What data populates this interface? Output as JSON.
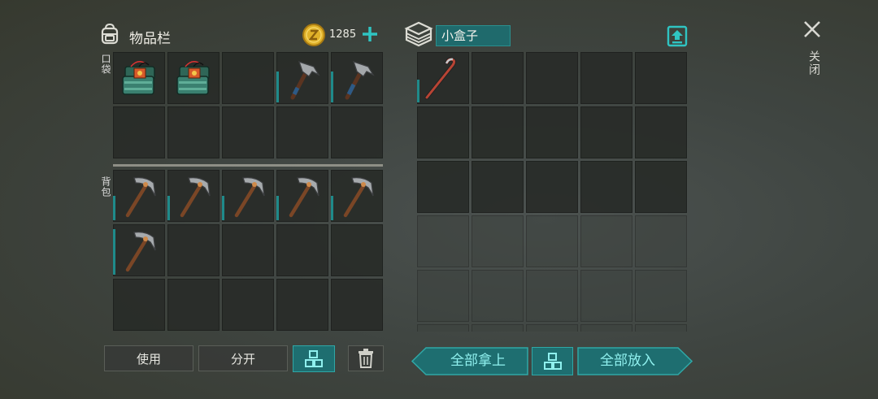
{
  "inventory": {
    "title": "物品栏",
    "coins": "1285",
    "pocket_label": "口袋",
    "backpack_label": "背包"
  },
  "container": {
    "name": "小盒子"
  },
  "close_label": "关闭",
  "buttons": {
    "use": "使用",
    "split": "分开",
    "take_all": "全部拿上",
    "put_all": "全部放入"
  },
  "pocket_slots": [
    "battery-pack",
    "battery-pack",
    "",
    "hammer",
    "hammer",
    "",
    "",
    "",
    "",
    ""
  ],
  "backpack_slots": [
    "pickaxe",
    "pickaxe",
    "pickaxe",
    "pickaxe",
    "pickaxe",
    "pickaxe",
    "",
    "",
    "",
    "",
    "",
    "",
    "",
    "",
    ""
  ],
  "container_slots": [
    "crowbar",
    "",
    "",
    "",
    "",
    "",
    "",
    "",
    "",
    "",
    "",
    "",
    "",
    "",
    "",
    "",
    "",
    "",
    "",
    "",
    "",
    "",
    "",
    "",
    "",
    "",
    "",
    "",
    "",
    ""
  ],
  "colors": {
    "accent": "#2fa7a6",
    "teal_button": "#1e6e70",
    "coin": "#e0b22a"
  }
}
